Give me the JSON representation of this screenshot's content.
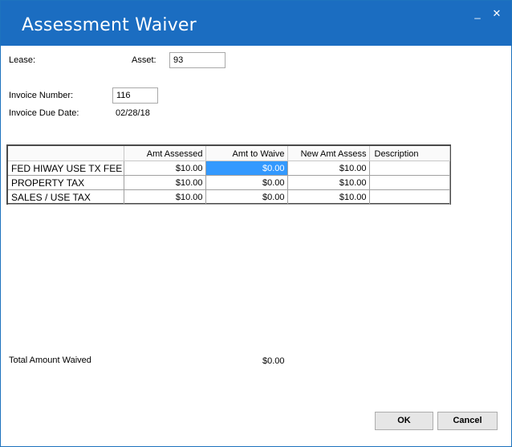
{
  "window": {
    "title": "Assessment Waiver",
    "minimize_glyph": "_",
    "close_glyph": "✕"
  },
  "form": {
    "lease_label": "Lease:",
    "asset_label": "Asset:",
    "asset_value": "93",
    "invoice_number_label": "Invoice Number:",
    "invoice_number_value": "116",
    "invoice_due_date_label": "Invoice Due Date:",
    "invoice_due_date_value": "02/28/18"
  },
  "grid": {
    "columns": [
      "",
      "Amt Assessed",
      "Amt to Waive",
      "New Amt Assess",
      "Description"
    ],
    "rows": [
      {
        "name": "FED HIWAY USE TX FEE",
        "assessed": "$10.00",
        "waive": "$0.00",
        "new_amt": "$10.00",
        "description": ""
      },
      {
        "name": "PROPERTY TAX",
        "assessed": "$10.00",
        "waive": "$0.00",
        "new_amt": "$10.00",
        "description": ""
      },
      {
        "name": "SALES / USE TAX",
        "assessed": "$10.00",
        "waive": "$0.00",
        "new_amt": "$10.00",
        "description": ""
      }
    ]
  },
  "totals": {
    "label": "Total Amount Waived",
    "value": "$0.00"
  },
  "buttons": {
    "ok": "OK",
    "cancel": "Cancel"
  }
}
